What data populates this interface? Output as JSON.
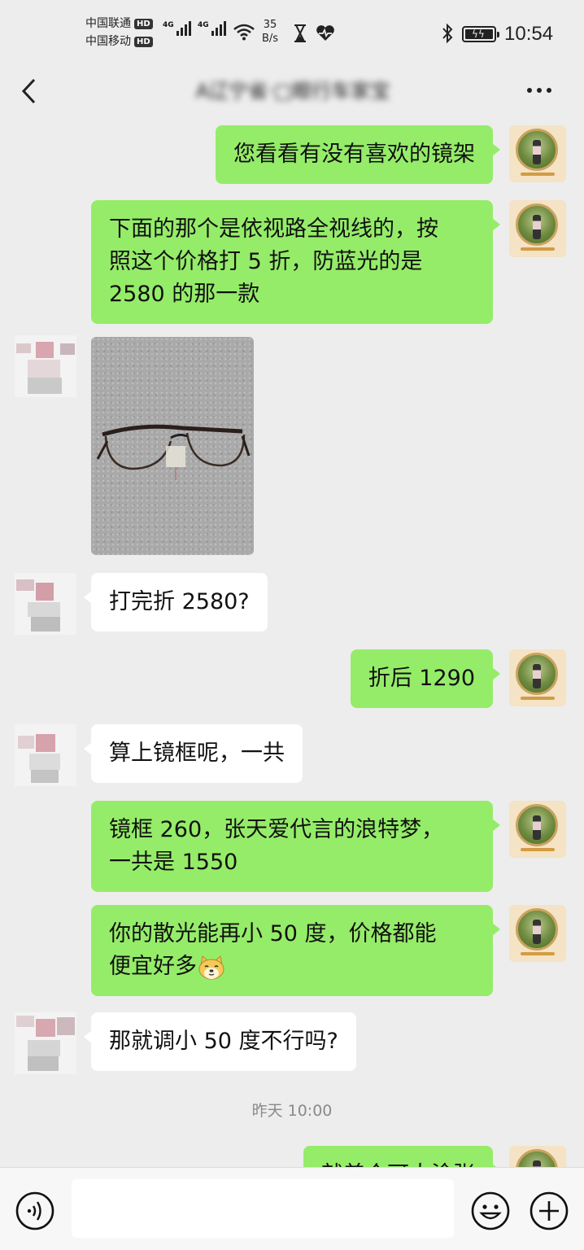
{
  "status_bar": {
    "carrier_1": "中国联通",
    "carrier_2": "中国移动",
    "hd_badge": "HD",
    "network_1": "4G",
    "network_2": "4G",
    "net_speed_value": "35",
    "net_speed_unit": "B/s",
    "time": "10:54"
  },
  "header": {
    "title": "A辽宁省·□眼行车家宝"
  },
  "messages": [
    {
      "side": "out",
      "lines": [
        "您看看有没有喜欢的镜架"
      ]
    },
    {
      "side": "out",
      "lines": [
        "下面的那个是依视路全视线的，按",
        "照这个价格打 5 折，防蓝光的是",
        "2580 的那一款"
      ]
    },
    {
      "side": "in",
      "type": "image",
      "image_desc": "glasses-photo"
    },
    {
      "side": "in",
      "lines": [
        "打完折 2580?"
      ]
    },
    {
      "side": "out",
      "lines": [
        "折后 1290"
      ]
    },
    {
      "side": "in",
      "lines": [
        "算上镜框呢，一共"
      ]
    },
    {
      "side": "out",
      "lines": [
        "镜框 260，张天爱代言的浪特梦，",
        "一共是 1550"
      ]
    },
    {
      "side": "out",
      "lines": [
        "你的散光能再小 50 度，价格都能",
        "便宜好多"
      ],
      "emoji": "doge-emoji"
    },
    {
      "side": "in",
      "lines": [
        "那就调小 50 度不行吗?"
      ]
    },
    {
      "side": "out",
      "lines": [
        "就差个可大涂张"
      ]
    }
  ],
  "timestamp": "昨天 10:00",
  "colors": {
    "background": "#ededed",
    "outgoing_bubble": "#95ec69",
    "incoming_bubble": "#ffffff",
    "input_bar": "#f7f7f7"
  },
  "icons": {
    "back": "chevron-left-icon",
    "more": "more-dots-icon",
    "voice": "voice-input-icon",
    "emoji": "emoji-icon",
    "plus": "plus-icon"
  }
}
